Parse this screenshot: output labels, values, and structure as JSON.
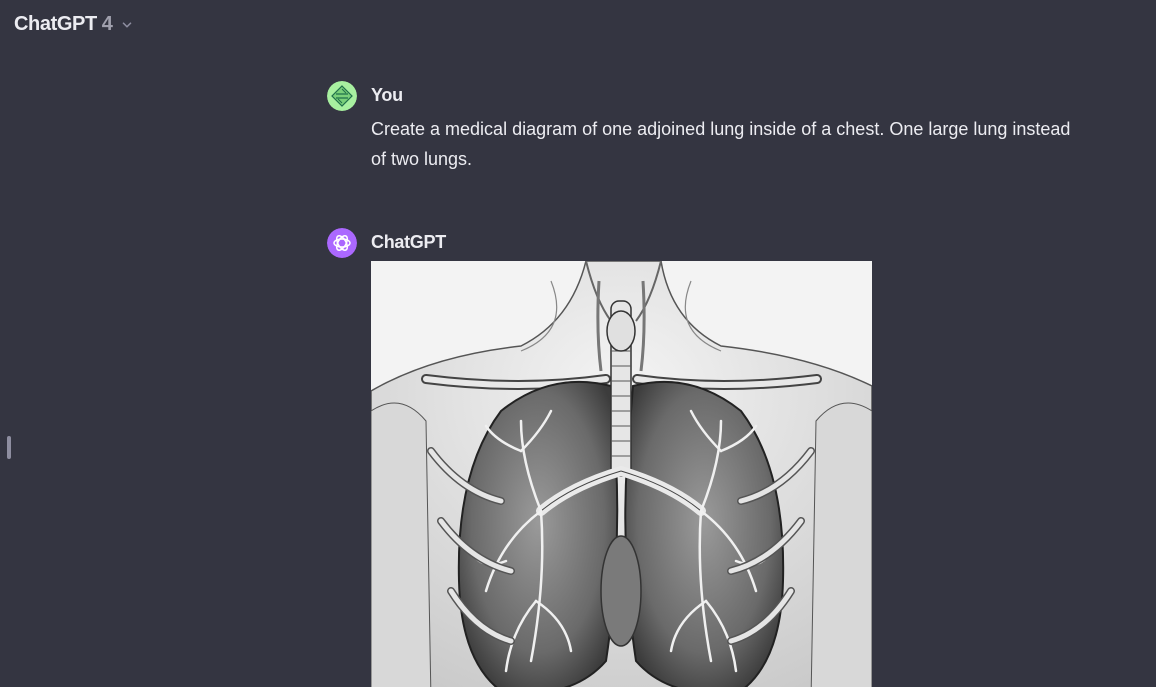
{
  "header": {
    "model_name": "ChatGPT",
    "model_version": "4",
    "chevron_icon": "chevron-down-icon"
  },
  "messages": [
    {
      "role": "user",
      "author": "You",
      "avatar_icon": "user-avatar-icon",
      "avatar_color": "#a8f0a0",
      "text": "Create a medical diagram of one adjoined lung inside of a chest. One large lung instead of two lungs."
    },
    {
      "role": "assistant",
      "author": "ChatGPT",
      "avatar_icon": "openai-logo-icon",
      "avatar_color": "#ab68ff",
      "image_alt": "Generated anatomical illustration of lungs inside a chest"
    }
  ],
  "colors": {
    "background": "#343541",
    "text": "#ececf1",
    "muted": "#a0a0ad"
  }
}
